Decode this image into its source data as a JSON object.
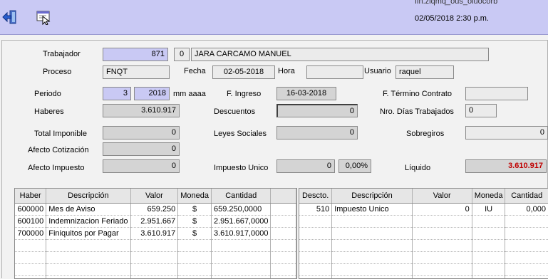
{
  "header": {
    "cut_text": "fin.ziqmq_ous_oiuocorb",
    "datetime": "02/05/2018 2:30 p.m."
  },
  "icons": {
    "exit": "exit-arrow-icon",
    "form": "form-window-icon"
  },
  "form": {
    "trabajador_label": "Trabajador",
    "trabajador_id": "871",
    "trabajador_sub": "0",
    "trabajador_name": "JARA CARCAMO MANUEL",
    "proceso_label": "Proceso",
    "proceso_value": "FNQT",
    "fecha_label": "Fecha",
    "fecha_value": "02-05-2018",
    "hora_label": "Hora",
    "hora_value": "",
    "usuario_label": "Usuario",
    "usuario_value": "raquel",
    "periodo_label": "Periodo",
    "periodo_month": "3",
    "periodo_year": "2018",
    "periodo_unit": "mm aaaa",
    "ingreso_label": "F. Ingreso",
    "ingreso_value": "16-03-2018",
    "termino_label": "F. Término Contrato",
    "termino_value": "",
    "haberes_label": "Haberes",
    "haberes_value": "3.610.917",
    "descuentos_label": "Descuentos",
    "descuentos_value": "0",
    "dias_label": "Nro. Días Trabajados",
    "dias_value": "0",
    "imponible_label": "Total Imponible",
    "imponible_value": "0",
    "leyes_label": "Leyes Sociales",
    "leyes_value": "0",
    "sobregiros_label": "Sobregiros",
    "sobregiros_value": "0",
    "cotizacion_label": "Afecto Cotización",
    "cotizacion_value": "0",
    "afecto_imp_label": "Afecto Impuesto",
    "afecto_imp_value": "0",
    "imp_unico_label": "Impuesto Unico",
    "imp_unico_value": "0",
    "imp_unico_pct": "0,00%",
    "liquido_label": "Líquido",
    "liquido_value": "3.610.917"
  },
  "haberes_table": {
    "headers": [
      "Haber",
      "Descripción",
      "Valor",
      "Moneda",
      "Cantidad",
      ""
    ],
    "rows": [
      [
        "600000",
        "Mes de Aviso",
        "659.250",
        "$",
        "659.250,0000",
        ""
      ],
      [
        "600100",
        "Indemnizacion Feriado",
        "2.951.667",
        "$",
        "2.951.667,0000",
        ""
      ],
      [
        "700000",
        "Finiquitos por Pagar",
        "3.610.917",
        "$",
        "3.610.917,0000",
        ""
      ],
      [
        "",
        "",
        "",
        "",
        "",
        ""
      ],
      [
        "",
        "",
        "",
        "",
        "",
        ""
      ],
      [
        "",
        "",
        "",
        "",
        "",
        ""
      ],
      [
        "",
        "",
        "",
        "",
        "",
        ""
      ]
    ]
  },
  "descuentos_table": {
    "headers": [
      "Descto.",
      "Descripción",
      "Valor",
      "Moneda",
      "Cantidad"
    ],
    "rows": [
      [
        "510",
        "Impuesto Unico",
        "0",
        "IU",
        "0,000"
      ],
      [
        "",
        "",
        "",
        "",
        ""
      ],
      [
        "",
        "",
        "",
        "",
        ""
      ],
      [
        "",
        "",
        "",
        "",
        ""
      ],
      [
        "",
        "",
        "",
        "",
        ""
      ],
      [
        "",
        "",
        "",
        "",
        ""
      ],
      [
        "",
        "",
        "",
        "",
        ""
      ]
    ]
  }
}
